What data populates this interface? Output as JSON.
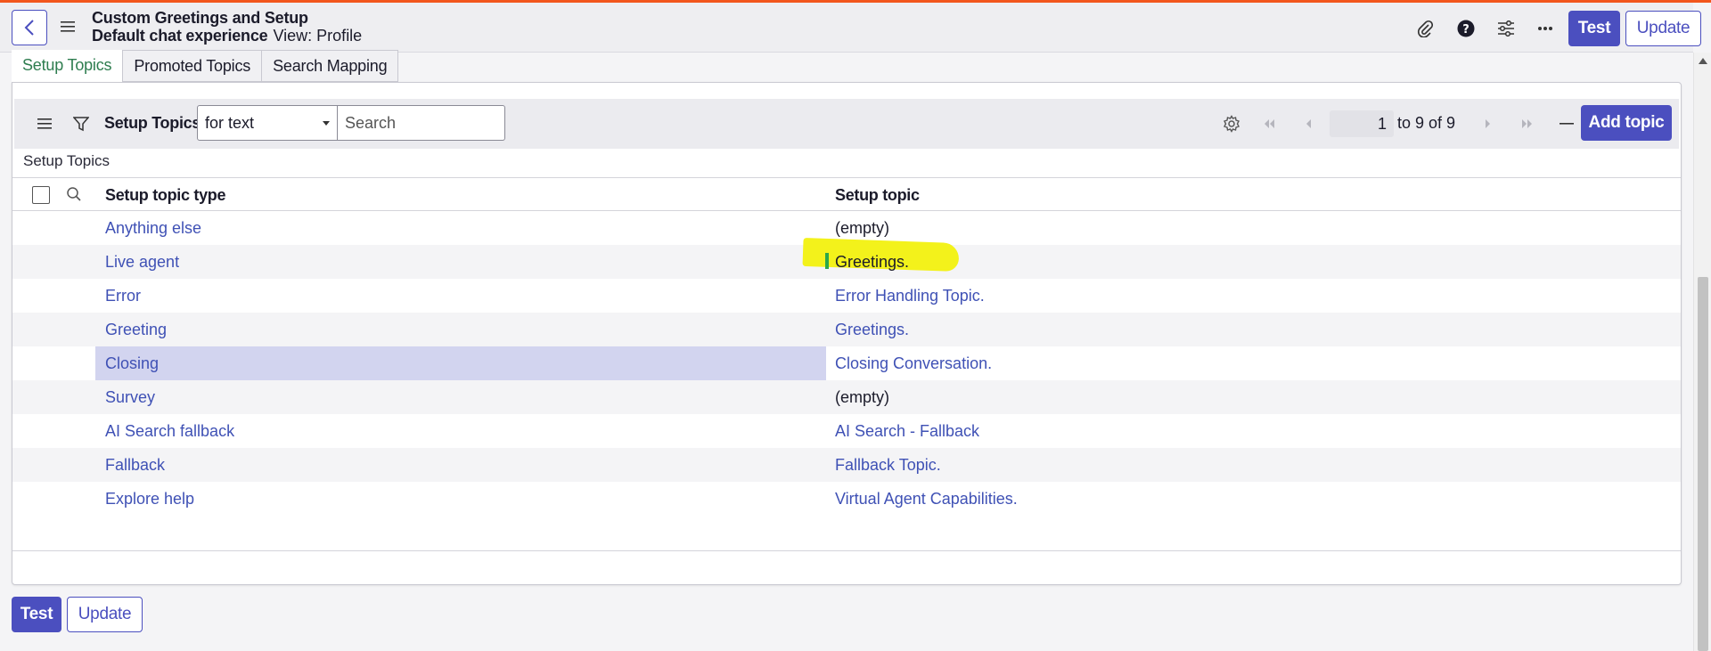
{
  "header": {
    "title": "Custom Greetings and Setup",
    "subtitle": "Default chat experience",
    "view": "View: Profile",
    "test_label": "Test",
    "update_label": "Update"
  },
  "tabs": [
    {
      "label": "Setup Topics",
      "active": true
    },
    {
      "label": "Promoted Topics",
      "active": false
    },
    {
      "label": "Search Mapping",
      "active": false
    }
  ],
  "list": {
    "title": "Setup Topics",
    "filter_value": "for text",
    "search_placeholder": "Search",
    "page_field": "1",
    "page_range": "to 9 of 9",
    "add_label": "Add topic",
    "breadcrumb": "Setup Topics",
    "columns": [
      "Setup topic type",
      "Setup topic"
    ],
    "rows": [
      {
        "type": "Anything else",
        "topic": "(empty)",
        "topic_link": false
      },
      {
        "type": "Live agent",
        "topic": "Greetings.",
        "topic_link": false
      },
      {
        "type": "Error",
        "topic": "Error Handling Topic.",
        "topic_link": true
      },
      {
        "type": "Greeting",
        "topic": "Greetings.",
        "topic_link": true
      },
      {
        "type": "Closing",
        "topic": "Closing Conversation.",
        "topic_link": true
      },
      {
        "type": "Survey",
        "topic": "(empty)",
        "topic_link": false
      },
      {
        "type": "AI Search fallback",
        "topic": "AI Search - Fallback",
        "topic_link": true
      },
      {
        "type": "Fallback",
        "topic": "Fallback Topic.",
        "topic_link": true
      },
      {
        "type": "Explore help",
        "topic": "Virtual Agent Capabilities.",
        "topic_link": true
      }
    ]
  },
  "footer": {
    "test_label": "Test",
    "update_label": "Update"
  },
  "colors": {
    "accent": "#4b4fbf",
    "top_bar": "#f2561d",
    "highlight": "#f3f21b",
    "link": "#3f51b5"
  },
  "icons": [
    "back-icon",
    "menu-icon",
    "paperclip-icon",
    "help-icon",
    "sliders-icon",
    "more-icon",
    "filter-icon",
    "gear-icon",
    "first-page-icon",
    "prev-page-icon",
    "next-page-icon",
    "last-page-icon",
    "collapse-icon",
    "search-icon"
  ]
}
